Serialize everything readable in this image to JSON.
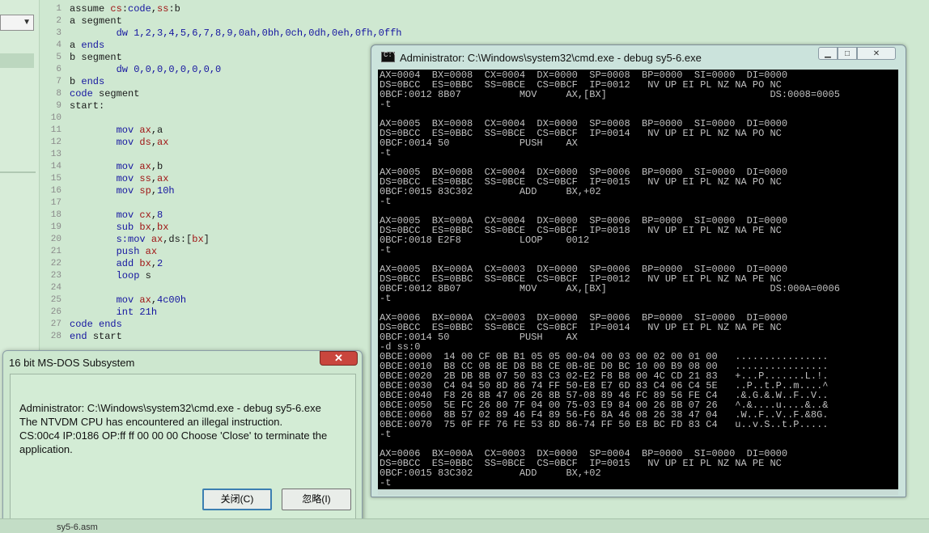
{
  "code_lines": [
    [
      {
        "t": "assume ",
        "c": ""
      },
      {
        "t": "cs",
        "c": "rg"
      },
      {
        "t": ":",
        "c": ""
      },
      {
        "t": "code",
        "c": "kw"
      },
      {
        "t": ",",
        "c": ""
      },
      {
        "t": "ss",
        "c": "rg"
      },
      {
        "t": ":b",
        "c": ""
      }
    ],
    [
      {
        "t": "a segment",
        "c": ""
      }
    ],
    [
      {
        "t": "        ",
        "c": ""
      },
      {
        "t": "dw 1,2,3,4,5,6,7,8,9,0ah,0bh,0ch,0dh,0eh,0fh,0ffh",
        "c": "nm"
      }
    ],
    [
      {
        "t": "a ",
        "c": ""
      },
      {
        "t": "ends",
        "c": "kw"
      }
    ],
    [
      {
        "t": "b segment",
        "c": ""
      }
    ],
    [
      {
        "t": "        ",
        "c": ""
      },
      {
        "t": "dw 0,0,0,0,0,0,0,0",
        "c": "nm"
      }
    ],
    [
      {
        "t": "b ",
        "c": ""
      },
      {
        "t": "ends",
        "c": "kw"
      }
    ],
    [
      {
        "t": "code",
        "c": "kw"
      },
      {
        "t": " segment",
        "c": ""
      }
    ],
    [
      {
        "t": "start:",
        "c": ""
      }
    ],
    [
      {
        "t": "",
        "c": ""
      }
    ],
    [
      {
        "t": "        ",
        "c": ""
      },
      {
        "t": "mov ",
        "c": "kw"
      },
      {
        "t": "ax",
        "c": "rg"
      },
      {
        "t": ",a",
        "c": ""
      }
    ],
    [
      {
        "t": "        ",
        "c": ""
      },
      {
        "t": "mov ",
        "c": "kw"
      },
      {
        "t": "ds",
        "c": "rg"
      },
      {
        "t": ",",
        "c": ""
      },
      {
        "t": "ax",
        "c": "rg"
      }
    ],
    [
      {
        "t": "",
        "c": ""
      }
    ],
    [
      {
        "t": "        ",
        "c": ""
      },
      {
        "t": "mov ",
        "c": "kw"
      },
      {
        "t": "ax",
        "c": "rg"
      },
      {
        "t": ",b",
        "c": ""
      }
    ],
    [
      {
        "t": "        ",
        "c": ""
      },
      {
        "t": "mov ",
        "c": "kw"
      },
      {
        "t": "ss",
        "c": "rg"
      },
      {
        "t": ",",
        "c": ""
      },
      {
        "t": "ax",
        "c": "rg"
      }
    ],
    [
      {
        "t": "        ",
        "c": ""
      },
      {
        "t": "mov ",
        "c": "kw"
      },
      {
        "t": "sp",
        "c": "rg"
      },
      {
        "t": ",",
        "c": ""
      },
      {
        "t": "10h",
        "c": "nm"
      }
    ],
    [
      {
        "t": "",
        "c": ""
      }
    ],
    [
      {
        "t": "        ",
        "c": ""
      },
      {
        "t": "mov ",
        "c": "kw"
      },
      {
        "t": "cx",
        "c": "rg"
      },
      {
        "t": ",",
        "c": ""
      },
      {
        "t": "8",
        "c": "nm"
      }
    ],
    [
      {
        "t": "        ",
        "c": ""
      },
      {
        "t": "sub ",
        "c": "kw"
      },
      {
        "t": "bx",
        "c": "rg"
      },
      {
        "t": ",",
        "c": ""
      },
      {
        "t": "bx",
        "c": "rg"
      }
    ],
    [
      {
        "t": "        ",
        "c": ""
      },
      {
        "t": "s:mov ",
        "c": "kw"
      },
      {
        "t": "ax",
        "c": "rg"
      },
      {
        "t": ",ds:[",
        "c": ""
      },
      {
        "t": "bx",
        "c": "rg"
      },
      {
        "t": "]",
        "c": ""
      }
    ],
    [
      {
        "t": "        ",
        "c": ""
      },
      {
        "t": "push ",
        "c": "kw"
      },
      {
        "t": "ax",
        "c": "rg"
      }
    ],
    [
      {
        "t": "        ",
        "c": ""
      },
      {
        "t": "add ",
        "c": "kw"
      },
      {
        "t": "bx",
        "c": "rg"
      },
      {
        "t": ",",
        "c": ""
      },
      {
        "t": "2",
        "c": "nm"
      }
    ],
    [
      {
        "t": "        ",
        "c": ""
      },
      {
        "t": "loop ",
        "c": "kw"
      },
      {
        "t": "s",
        "c": ""
      }
    ],
    [
      {
        "t": "",
        "c": ""
      }
    ],
    [
      {
        "t": "        ",
        "c": ""
      },
      {
        "t": "mov ",
        "c": "kw"
      },
      {
        "t": "ax",
        "c": "rg"
      },
      {
        "t": ",",
        "c": ""
      },
      {
        "t": "4c00h",
        "c": "nm"
      }
    ],
    [
      {
        "t": "        ",
        "c": ""
      },
      {
        "t": "int ",
        "c": "kw"
      },
      {
        "t": "21h",
        "c": "nm"
      }
    ],
    [
      {
        "t": "code ",
        "c": "kw"
      },
      {
        "t": "ends",
        "c": "kw"
      }
    ],
    [
      {
        "t": "end ",
        "c": "kw"
      },
      {
        "t": "start",
        "c": ""
      }
    ]
  ],
  "cmd": {
    "title": "Administrator: C:\\Windows\\system32\\cmd.exe - debug  sy5-6.exe",
    "icon_glyph": "C:\\",
    "minimize": "▁",
    "maximize": "□",
    "close": "✕",
    "lines": [
      "AX=0004  BX=0008  CX=0004  DX=0000  SP=0008  BP=0000  SI=0000  DI=0000",
      "DS=0BCC  ES=0BBC  SS=0BCE  CS=0BCF  IP=0012   NV UP EI PL NZ NA PO NC",
      "0BCF:0012 8B07          MOV     AX,[BX]                            DS:0008=0005",
      "-t",
      "",
      "AX=0005  BX=0008  CX=0004  DX=0000  SP=0008  BP=0000  SI=0000  DI=0000",
      "DS=0BCC  ES=0BBC  SS=0BCE  CS=0BCF  IP=0014   NV UP EI PL NZ NA PO NC",
      "0BCF:0014 50            PUSH    AX",
      "-t",
      "",
      "AX=0005  BX=0008  CX=0004  DX=0000  SP=0006  BP=0000  SI=0000  DI=0000",
      "DS=0BCC  ES=0BBC  SS=0BCE  CS=0BCF  IP=0015   NV UP EI PL NZ NA PO NC",
      "0BCF:0015 83C302        ADD     BX,+02",
      "-t",
      "",
      "AX=0005  BX=000A  CX=0004  DX=0000  SP=0006  BP=0000  SI=0000  DI=0000",
      "DS=0BCC  ES=0BBC  SS=0BCE  CS=0BCF  IP=0018   NV UP EI PL NZ NA PE NC",
      "0BCF:0018 E2F8          LOOP    0012",
      "-t",
      "",
      "AX=0005  BX=000A  CX=0003  DX=0000  SP=0006  BP=0000  SI=0000  DI=0000",
      "DS=0BCC  ES=0BBC  SS=0BCE  CS=0BCF  IP=0012   NV UP EI PL NZ NA PE NC",
      "0BCF:0012 8B07          MOV     AX,[BX]                            DS:000A=0006",
      "-t",
      "",
      "AX=0006  BX=000A  CX=0003  DX=0000  SP=0006  BP=0000  SI=0000  DI=0000",
      "DS=0BCC  ES=0BBC  SS=0BCE  CS=0BCF  IP=0014   NV UP EI PL NZ NA PE NC",
      "0BCF:0014 50            PUSH    AX",
      "-d ss:0",
      "0BCE:0000  14 00 CF 0B B1 05 05 00-04 00 03 00 02 00 01 00   ................",
      "0BCE:0010  B8 CC 0B 8E D8 B8 CE 0B-8E D0 BC 10 00 B9 08 00   ................",
      "0BCE:0020  2B DB 8B 07 50 83 C3 02-E2 F8 B8 00 4C CD 21 83   +...P.......L.!.",
      "0BCE:0030  C4 04 50 8D 86 74 FF 50-E8 E7 6D 83 C4 06 C4 5E   ..P..t.P..m....^",
      "0BCE:0040  F8 26 8B 47 06 26 8B 57-08 89 46 FC 89 56 FE C4   .&.G.&.W..F..V..",
      "0BCE:0050  5E FC 26 80 7F 04 00 75-03 E9 84 00 26 8B 07 26   ^.&....u....&..&",
      "0BCE:0060  8B 57 02 89 46 F4 89 56-F6 8A 46 08 26 38 47 04   .W..F..V..F.&8G.",
      "0BCE:0070  75 0F FF 76 FE 53 8D 86-74 FF 50 E8 BC FD 83 C4   u..v.S..t.P.....",
      "-t",
      "",
      "AX=0006  BX=000A  CX=0003  DX=0000  SP=0004  BP=0000  SI=0000  DI=0000",
      "DS=0BCC  ES=0BBC  SS=0BCE  CS=0BCF  IP=0015   NV UP EI PL NZ NA PE NC",
      "0BCF:0015 83C302        ADD     BX,+02",
      "-t"
    ]
  },
  "dialog": {
    "title": "16 bit MS-DOS Subsystem",
    "close": "✕",
    "message_lines": [
      "Administrator: C:\\Windows\\system32\\cmd.exe - debug  sy5-6.exe",
      "The NTVDM CPU has encountered an illegal instruction.",
      "CS:00c4 IP:0186 OP:ff ff 00 00 00 Choose 'Close' to terminate the",
      "application."
    ],
    "close_button": "关闭(C)",
    "ignore_button": "忽略(I)"
  },
  "status": {
    "tab_label": "sy5-6.asm"
  },
  "colors": {
    "editor_bg": "#cfe8d1",
    "keyword": "#1515a0",
    "register": "#a01515",
    "console_bg": "#000000",
    "console_fg": "#c0c0c0"
  }
}
